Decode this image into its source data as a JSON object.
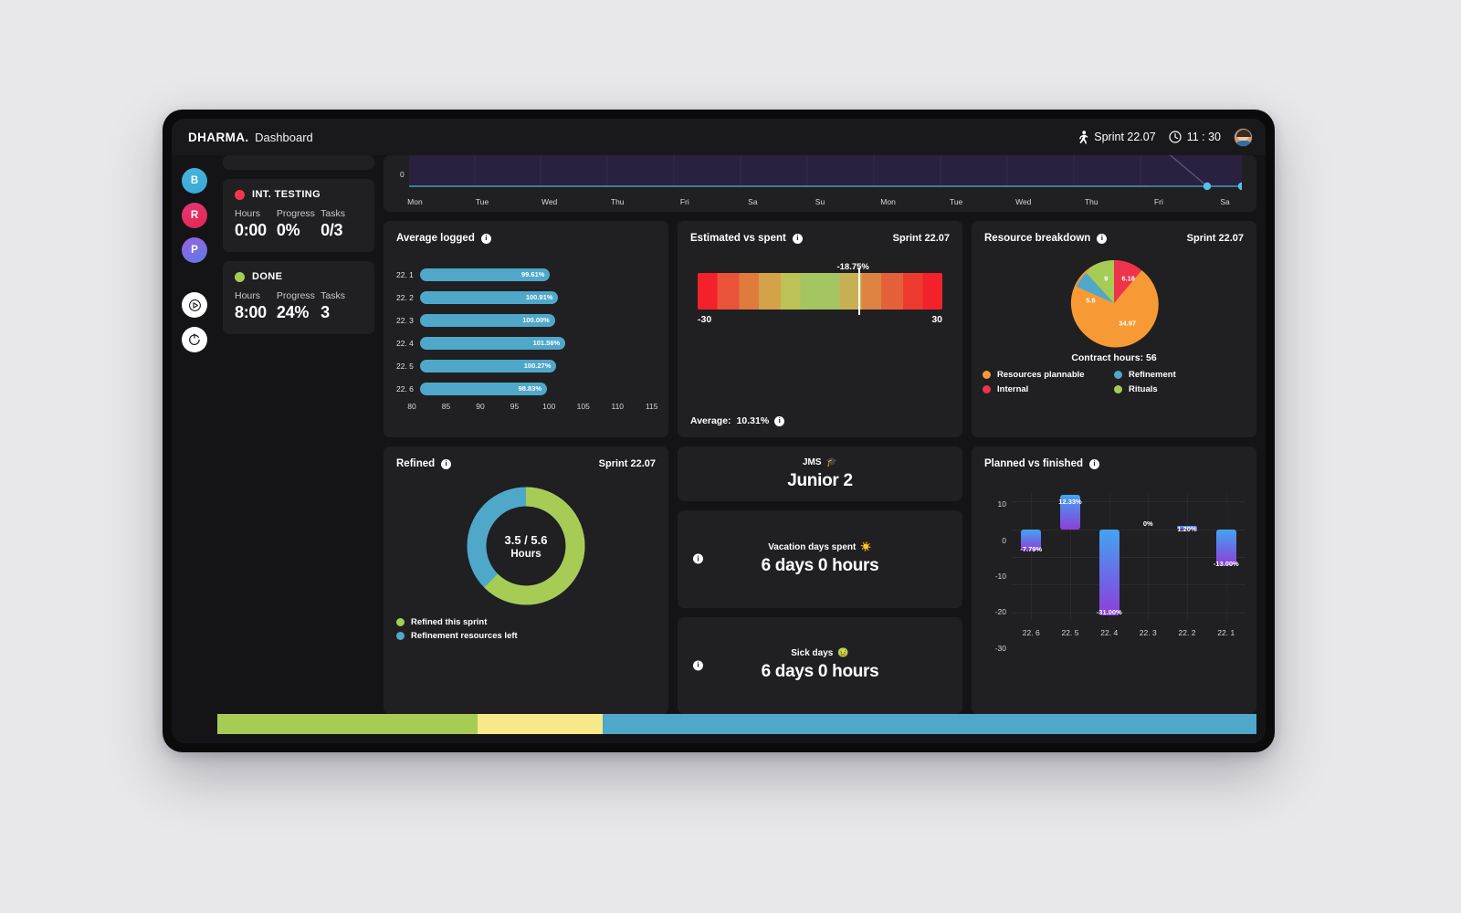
{
  "app": {
    "brand": "DHARMA",
    "brand_dot": ".",
    "section": "Dashboard"
  },
  "topbar": {
    "sprint_icon": "running-icon",
    "sprint": "Sprint 22.07",
    "clock_icon": "clock-icon",
    "time": "11 : 30",
    "avatar": "user-avatar"
  },
  "rail": {
    "badges": [
      {
        "label": "B",
        "color": "#3fa8d8"
      },
      {
        "label": "R",
        "color": "#e2274f"
      },
      {
        "label": "P",
        "color": "#7a63e3"
      }
    ],
    "buttons": [
      {
        "name": "play-button",
        "icon": "play-icon"
      },
      {
        "name": "refresh-button",
        "icon": "refresh-icon"
      }
    ]
  },
  "status_cards": [
    {
      "title": "INT. TESTING",
      "dot_color": "#f4354a",
      "labels": {
        "hours": "Hours",
        "progress": "Progress",
        "tasks": "Tasks"
      },
      "values": {
        "hours": "0:00",
        "progress": "0%",
        "tasks": "0/3"
      }
    },
    {
      "title": "DONE",
      "dot_color": "#a6cc55",
      "labels": {
        "hours": "Hours",
        "progress": "Progress",
        "tasks": "Tasks"
      },
      "values": {
        "hours": "8:00",
        "progress": "24%",
        "tasks": "3"
      }
    }
  ],
  "panels": {
    "average_logged": {
      "title": "Average logged",
      "info_icon": "info-icon"
    },
    "estimated_vs_spent": {
      "title": "Estimated vs spent",
      "info_icon": "info-icon",
      "sprint": "Sprint 22.07",
      "marker_label": "-18.75%",
      "scale_min": "-30",
      "scale_max": "30",
      "average_label": "Average:",
      "average_value": "10.31%",
      "average_info_icon": "info-icon"
    },
    "resource_breakdown": {
      "title": "Resource breakdown",
      "info_icon": "info-icon",
      "sprint": "Sprint 22.07",
      "contract_label": "Contract hours:",
      "contract_value": "56"
    },
    "refined": {
      "title": "Refined",
      "info_icon": "info-icon",
      "sprint": "Sprint 22.07",
      "center_value": "3.5 / 5.6",
      "center_unit": "Hours"
    },
    "role_card": {
      "code": "JMS",
      "emoji": "🎓",
      "level": "Junior 2"
    },
    "vacation": {
      "info_icon": "info-icon",
      "label": "Vacation days spent",
      "emoji": "☀️",
      "value": "6 days 0 hours"
    },
    "sick": {
      "info_icon": "info-icon",
      "label": "Sick days",
      "emoji": "🤢",
      "value": "6 days 0 hours"
    },
    "planned_vs_finished": {
      "title": "Planned vs finished",
      "info_icon": "info-icon"
    }
  },
  "chart_data": [
    {
      "type": "line",
      "name": "burndown",
      "title": "",
      "xlabel": "",
      "ylabel": "",
      "x": [
        "Mon",
        "Tue",
        "Wed",
        "Thu",
        "Fri",
        "Sa",
        "Su",
        "Mon",
        "Tue",
        "Wed",
        "Thu",
        "Fri",
        "Sa"
      ],
      "values": [
        0,
        0,
        0,
        0,
        0,
        0,
        0,
        0,
        0,
        0,
        0,
        0,
        0
      ],
      "y_tick_labels": [
        "0"
      ],
      "grid": true,
      "markers": [
        "Fri",
        "Sa"
      ],
      "line_color": "#4fa8c9",
      "area_color": "#2a2140"
    },
    {
      "type": "bar",
      "name": "average_logged",
      "title": "Average logged",
      "orientation": "horizontal",
      "categories": [
        "22. 1",
        "22. 2",
        "22. 3",
        "22. 4",
        "22. 5",
        "22. 6"
      ],
      "values": [
        99.61,
        100.91,
        100.0,
        101.56,
        100.27,
        98.83
      ],
      "data_labels": [
        "99.61%",
        "100.91%",
        "100.00%",
        "101.56%",
        "100.27%",
        "98.83%"
      ],
      "xlim": [
        78,
        117
      ],
      "x_ticks": [
        80,
        85,
        90,
        95,
        100,
        105,
        110,
        115
      ],
      "x_tick_labels": [
        "80",
        "85",
        "90",
        "95",
        "100",
        "105",
        "110",
        "115"
      ],
      "bar_color": "#4fa8c9",
      "grid": true
    },
    {
      "type": "gauge",
      "name": "estimated_vs_spent",
      "title": "Estimated vs spent",
      "range": [
        -30,
        30
      ],
      "tick_labels": [
        "-30",
        "30"
      ],
      "marker_value": -18.75,
      "marker_label": "-18.75%",
      "average_value": 10.31,
      "average_label": "10.31%",
      "colors": [
        "#f3222a",
        "#e8533a",
        "#df7b3c",
        "#d4a249",
        "#bdc256",
        "#a4c662",
        "#c6b053",
        "#dd8341",
        "#e4603a",
        "#ee3a2e",
        "#f3222a"
      ]
    },
    {
      "type": "pie",
      "name": "resource_breakdown",
      "title": "Resource breakdown",
      "labels": [
        "Resources plannable",
        "Internal",
        "Refinement",
        "Rituals"
      ],
      "values": [
        34.97,
        6.18,
        5.6,
        9
      ],
      "data_labels": [
        "34.97",
        "6.18",
        "5.6",
        "9"
      ],
      "colors": [
        "#f79a35",
        "#f0334c",
        "#4fa8c9",
        "#a6cc55"
      ],
      "legend": "bottom",
      "annotation": "Contract hours: 56"
    },
    {
      "type": "pie",
      "name": "refined_donut",
      "title": "Refined",
      "labels": [
        "Refined this sprint",
        "Refinement resources left"
      ],
      "values": [
        3.5,
        2.1
      ],
      "total": 5.6,
      "center_label": "3.5 / 5.6 Hours",
      "colors": [
        "#a6cc55",
        "#4fa8c9"
      ],
      "legend": "bottom",
      "donut": true
    },
    {
      "type": "bar",
      "name": "planned_vs_finished",
      "title": "Planned vs finished",
      "categories": [
        "22. 6",
        "22. 5",
        "22. 4",
        "22. 3",
        "22. 2",
        "22. 1"
      ],
      "values": [
        -7.79,
        12.33,
        -31.0,
        0,
        1.2,
        -13.0
      ],
      "data_labels": [
        "-7.79%",
        "12.33%",
        "-31.00%",
        "0%",
        "1.20%",
        "-13.00%"
      ],
      "ylim": [
        -33,
        13
      ],
      "y_ticks": [
        10,
        0,
        -10,
        -20,
        -30
      ],
      "y_tick_labels": [
        "10",
        "0",
        "-10",
        "-20",
        "-30"
      ],
      "grid": true,
      "bar_gradient": [
        "#45a4ef",
        "#8e3fd6"
      ]
    }
  ],
  "bottom_bar": {
    "segments": [
      {
        "name": "green",
        "color": "#a6cc55",
        "pct": 25
      },
      {
        "name": "yellow",
        "color": "#f7e889",
        "pct": 12.1
      },
      {
        "name": "blue",
        "color": "#4fa8c9",
        "pct": 62.9
      }
    ]
  },
  "legend_labels": {
    "resources_plannable": "Resources plannable",
    "internal": "Internal",
    "refinement": "Refinement",
    "rituals": "Rituals",
    "refined_this_sprint": "Refined this sprint",
    "refinement_resources_left": "Refinement resources left"
  }
}
